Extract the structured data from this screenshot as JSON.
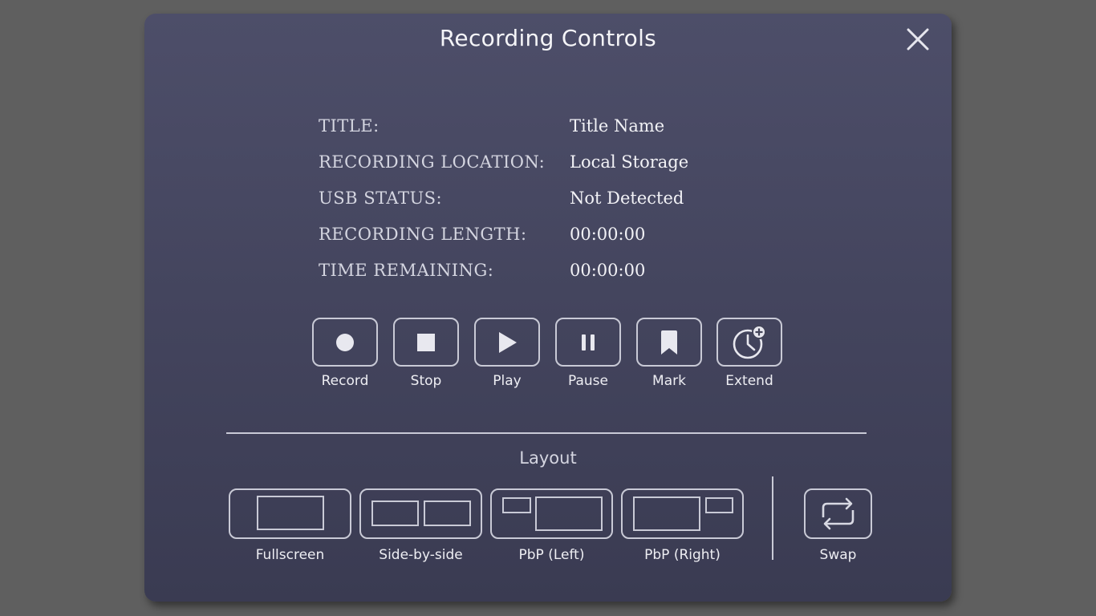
{
  "modal": {
    "title": "Recording Controls",
    "close_icon": "close-x-icon"
  },
  "info": {
    "rows": [
      {
        "label": "TITLE:",
        "value": "Title Name"
      },
      {
        "label": "RECORDING LOCATION:",
        "value": "Local Storage"
      },
      {
        "label": "USB STATUS:",
        "value": "Not Detected"
      },
      {
        "label": "RECORDING LENGTH:",
        "value": "00:00:00"
      },
      {
        "label": "TIME REMAINING:",
        "value": "00:00:00"
      }
    ]
  },
  "controls": [
    {
      "label": "Record",
      "icon": "record-icon"
    },
    {
      "label": "Stop",
      "icon": "stop-icon"
    },
    {
      "label": "Play",
      "icon": "play-icon"
    },
    {
      "label": "Pause",
      "icon": "pause-icon"
    },
    {
      "label": "Mark",
      "icon": "bookmark-icon"
    },
    {
      "label": "Extend",
      "icon": "clock-plus-icon"
    }
  ],
  "layout": {
    "title": "Layout",
    "options": [
      {
        "label": "Fullscreen",
        "icon": "fullscreen-layout-icon"
      },
      {
        "label": "Side-by-side",
        "icon": "side-by-side-layout-icon"
      },
      {
        "label": "PbP (Left)",
        "icon": "pbp-left-layout-icon"
      },
      {
        "label": "PbP (Right)",
        "icon": "pbp-right-layout-icon"
      }
    ],
    "swap": {
      "label": "Swap",
      "icon": "swap-icon"
    }
  },
  "colors": {
    "modal_top": "#4d4e69",
    "modal_bottom": "#3a3b52",
    "outline": "#c9cad6",
    "backdrop": "#5f5f5f"
  }
}
